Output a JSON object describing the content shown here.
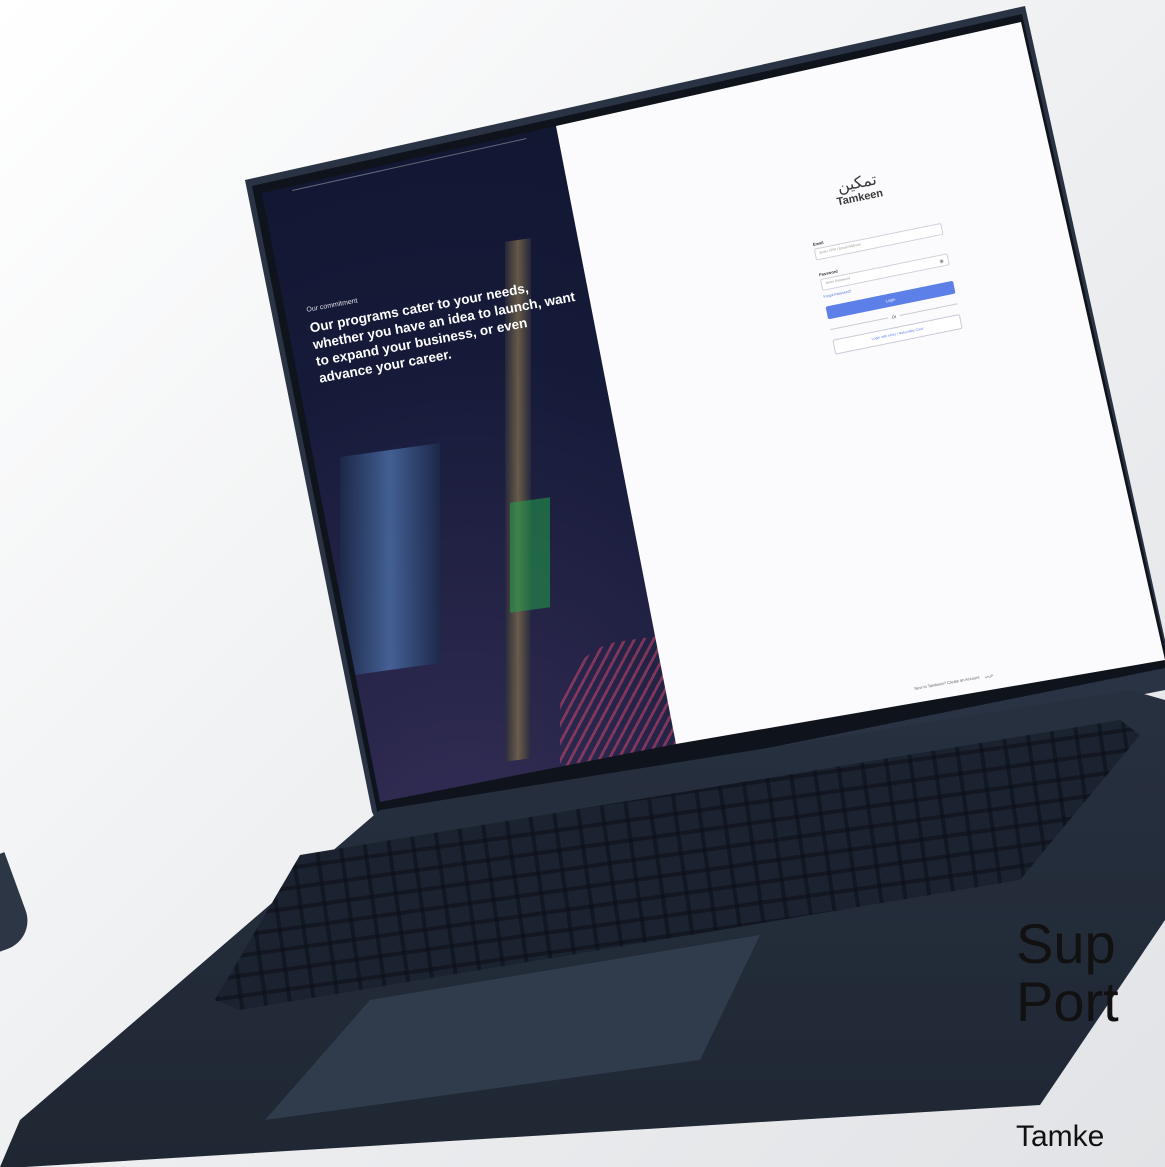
{
  "dark_panel": {
    "label": "Our commitment",
    "text": "Our programs cater to your needs, whether you have an idea to launch, want to expand your business, or even advance your career."
  },
  "login": {
    "logo_arabic": "تمكين",
    "logo_english": "Tamkeen",
    "email_label": "Email",
    "email_placeholder": "Enter CPR / Email Address",
    "password_label": "Password",
    "password_placeholder": "Enter Password",
    "forgot_password": "Forgot Password?",
    "login_button": "Login",
    "or_text": "Or",
    "alt_login_button": "Login with eKey / Nationality Card",
    "footer_text": "New to Tamkeen? Create an Account",
    "footer_lang": "عربي"
  },
  "promo": {
    "headline_line1": "Sup",
    "headline_line2": "Port",
    "subline": "Tamke"
  },
  "colors": {
    "accent": "#5d7fe8",
    "laptop_body": "#2d3747",
    "dark_panel_bg": "#151a38"
  }
}
